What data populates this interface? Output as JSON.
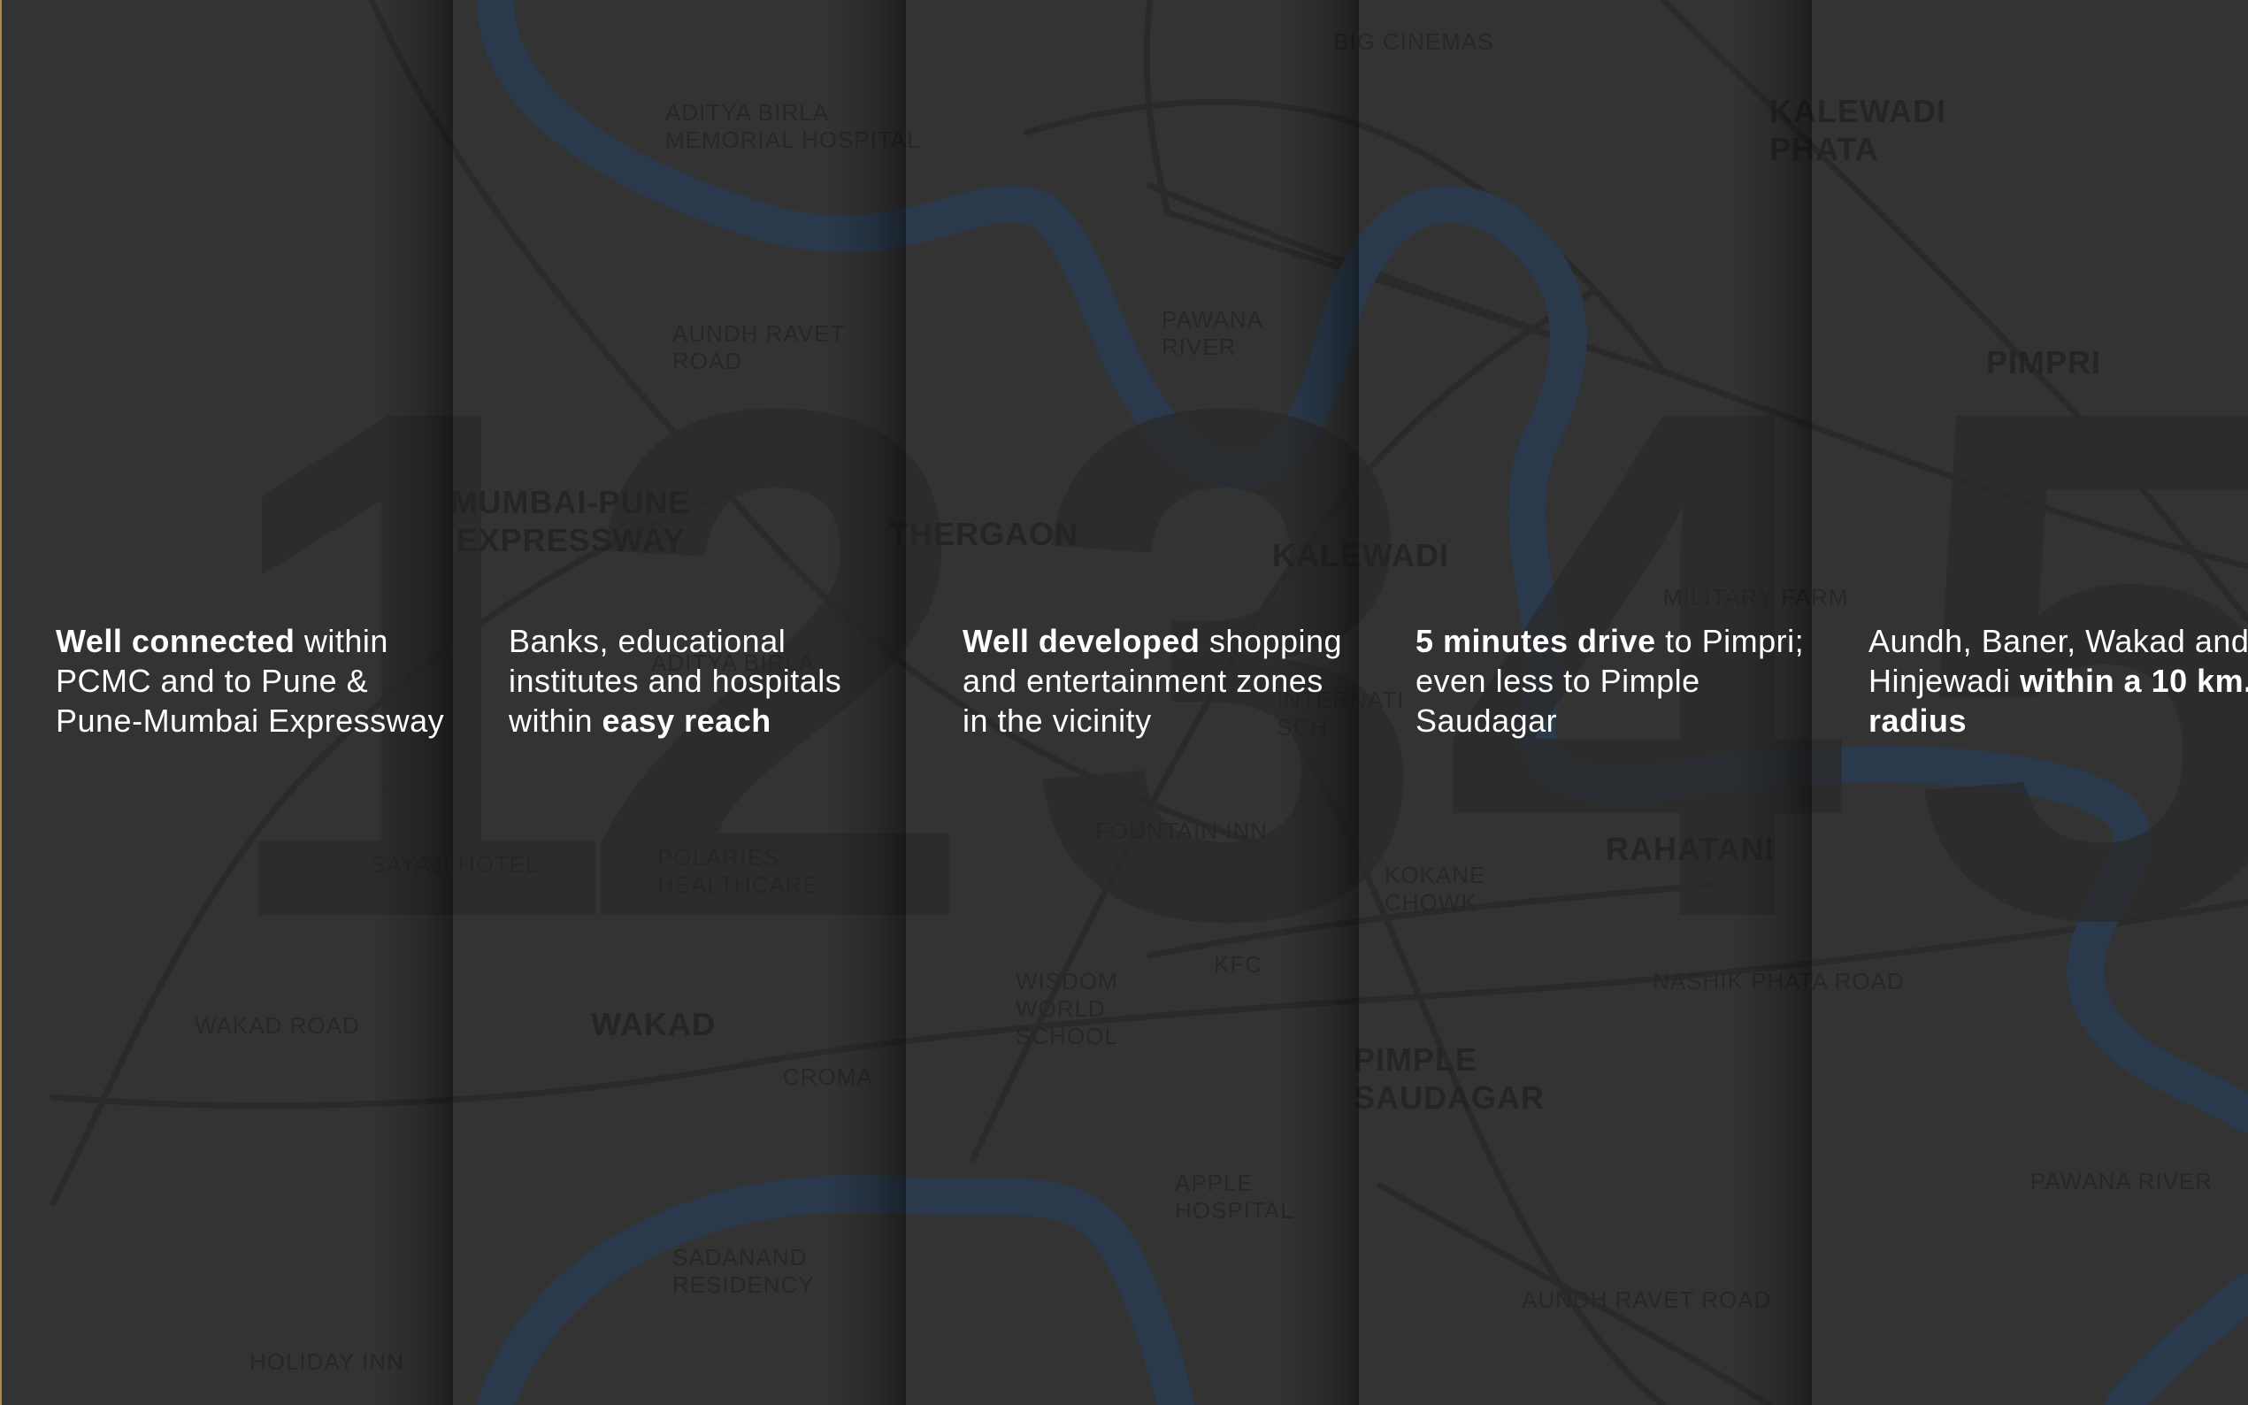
{
  "colors": {
    "background": "#333333",
    "river": "#2a3a4d",
    "road": "#2b2b2b",
    "text": "#ffffff",
    "map_label": "#262626"
  },
  "numbers": [
    "1",
    "2",
    "3",
    "4",
    "5"
  ],
  "panels": [
    {
      "bold": "Well connected",
      "rest": " within PCMC and to Pune & Pune-Mumbai Expressway",
      "bold_last": ""
    },
    {
      "bold": "",
      "rest": "Banks, educational institutes and hospitals within ",
      "bold_last": "easy reach"
    },
    {
      "bold": "Well developed",
      "rest": " shopping and entertainment zones in the vicinity",
      "bold_last": ""
    },
    {
      "bold": "5 minutes drive",
      "rest": " to Pimpri; even less to Pimple Saudagar",
      "bold_last": ""
    },
    {
      "bold": "",
      "rest": "Aundh, Baner, Wakad and Hinjewadi ",
      "bold_last": "within a 10 km. radius"
    }
  ],
  "map_labels": [
    {
      "text": "BIG CINEMAS",
      "size": "small"
    },
    {
      "text": "ADITYA BIRLA MEMORIAL HOSPITAL",
      "size": "small"
    },
    {
      "text": "KALEWADI PHATA",
      "size": "big"
    },
    {
      "text": "AUNDH RAVET ROAD",
      "size": "small"
    },
    {
      "text": "PAWANA RIVER",
      "size": "small"
    },
    {
      "text": "PIMPRI",
      "size": "big"
    },
    {
      "text": "MUMBAI-PUNE EXPRESSWAY",
      "size": "big"
    },
    {
      "text": "THERGAON",
      "size": "big"
    },
    {
      "text": "KALEWADI",
      "size": "big"
    },
    {
      "text": "MILITARY FARM",
      "size": "small"
    },
    {
      "text": "ADITYA BIRLA",
      "size": "small"
    },
    {
      "text": "INTERNATI SCH",
      "size": "small"
    },
    {
      "text": "FOUNTAIN INN",
      "size": "small"
    },
    {
      "text": "RAHATANI",
      "size": "big"
    },
    {
      "text": "SAYAJI HOTEL",
      "size": "small"
    },
    {
      "text": "POLARIES HEALTHCARE",
      "size": "small"
    },
    {
      "text": "KOKANE CHOWK",
      "size": "small"
    },
    {
      "text": "KFC",
      "size": "small"
    },
    {
      "text": "NASHIK PHATA ROAD",
      "size": "small"
    },
    {
      "text": "WISDOM WORLD SCHOOL",
      "size": "small"
    },
    {
      "text": "WAKAD ROAD",
      "size": "small"
    },
    {
      "text": "WAKAD",
      "size": "big"
    },
    {
      "text": "CROMA",
      "size": "small"
    },
    {
      "text": "PIMPLE SAUDAGAR",
      "size": "big"
    },
    {
      "text": "APPLE HOSPITAL",
      "size": "small"
    },
    {
      "text": "PAWANA RIVER",
      "size": "small"
    },
    {
      "text": "SADANAND RESIDENCY",
      "size": "small"
    },
    {
      "text": "AUNDH RAVET ROAD",
      "size": "small"
    },
    {
      "text": "HOLIDAY INN",
      "size": "small"
    }
  ]
}
